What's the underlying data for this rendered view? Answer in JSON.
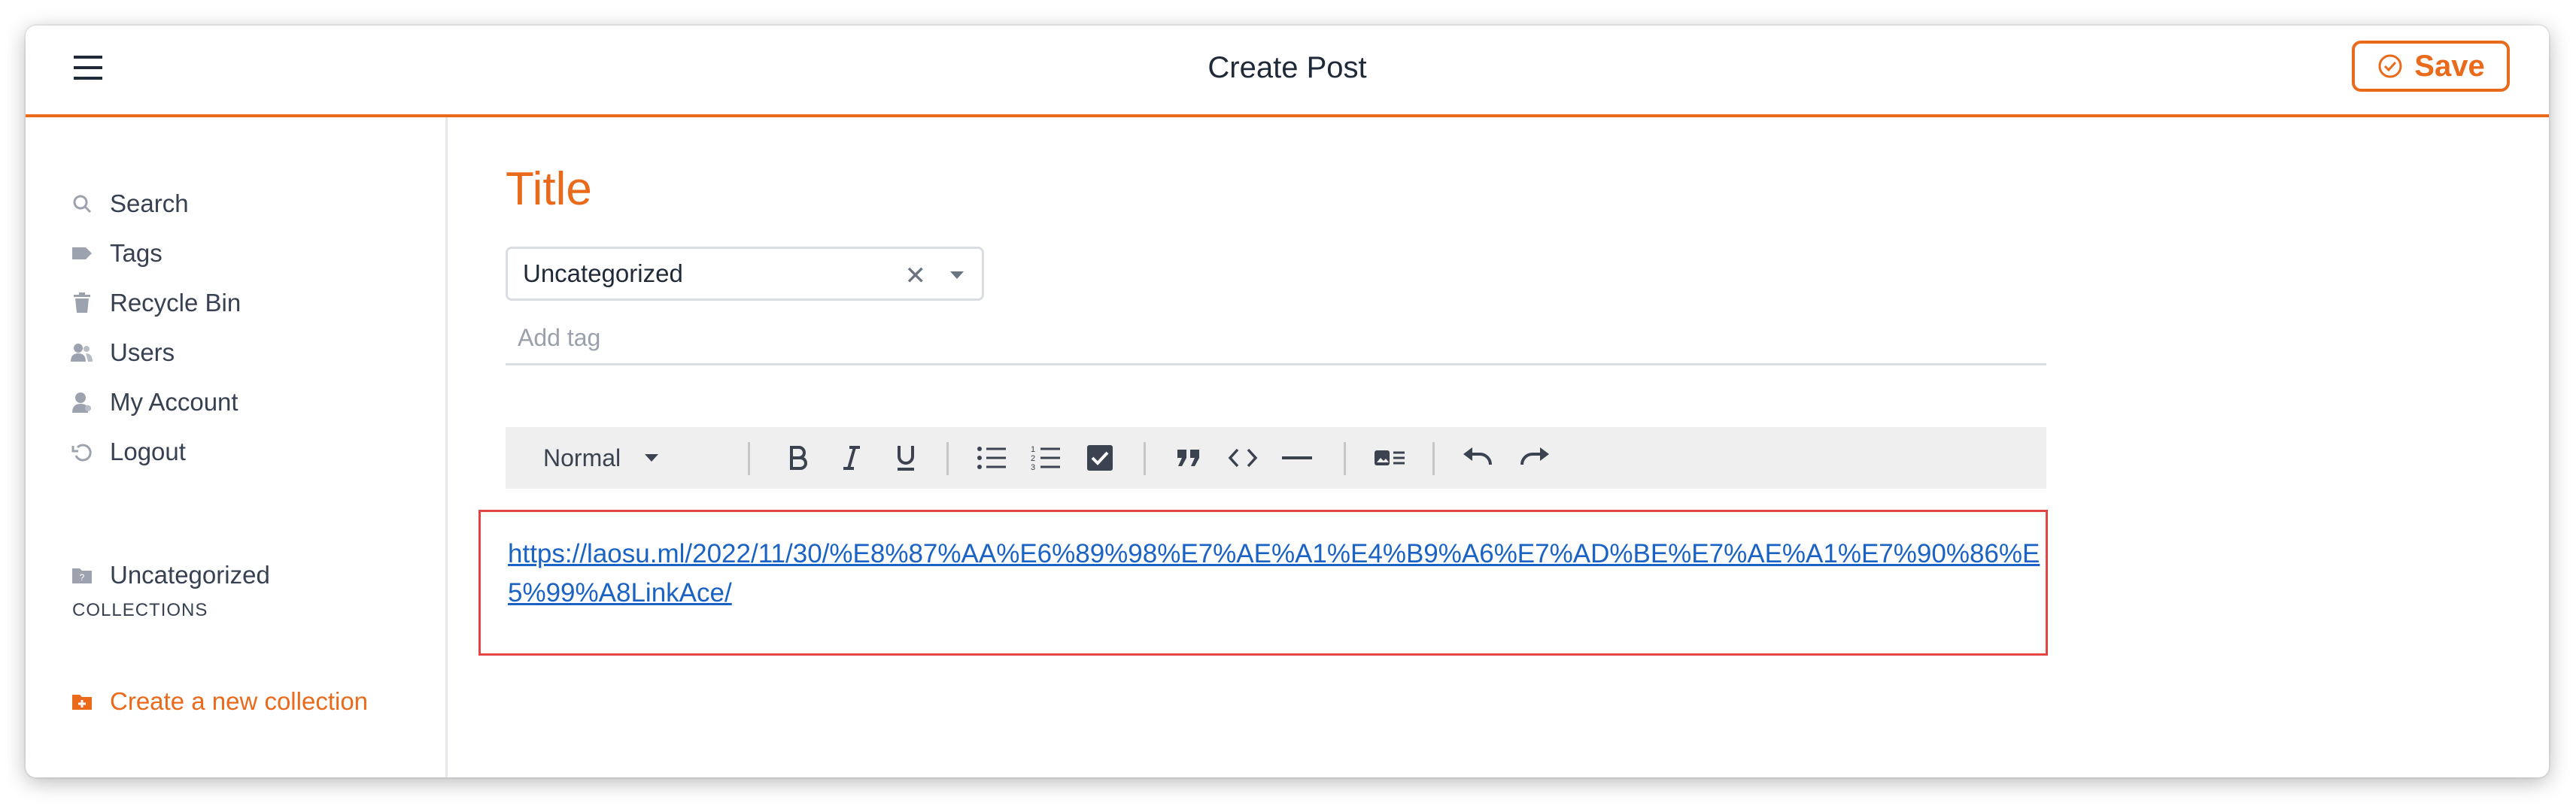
{
  "header": {
    "title": "Create Post",
    "save_label": "Save"
  },
  "sidebar": {
    "items": [
      {
        "label": "Search",
        "icon": "search-icon"
      },
      {
        "label": "Tags",
        "icon": "tag-icon"
      },
      {
        "label": "Recycle Bin",
        "icon": "trash-icon"
      },
      {
        "label": "Users",
        "icon": "users-icon"
      },
      {
        "label": "My Account",
        "icon": "account-icon"
      },
      {
        "label": "Logout",
        "icon": "logout-icon"
      }
    ],
    "collection_item": {
      "label": "Uncategorized",
      "icon": "folder-icon"
    },
    "collections_heading": "COLLECTIONS",
    "create_collection_label": "Create a new collection"
  },
  "post": {
    "title": "Title",
    "category": "Uncategorized",
    "tag_placeholder": "Add tag",
    "body_link": "https://laosu.ml/2022/11/30/%E8%87%AA%E6%89%98%E7%AE%A1%E4%B9%A6%E7%AD%BE%E7%AE%A1%E7%90%86%E5%99%A8LinkAce/"
  },
  "toolbar": {
    "format_label": "Normal",
    "buttons": [
      "bold-icon",
      "italic-icon",
      "underline-icon",
      "bullet-list-icon",
      "ordered-list-icon",
      "checklist-icon",
      "quote-icon",
      "code-icon",
      "horizontal-rule-icon",
      "embed-card-icon",
      "undo-icon",
      "redo-icon"
    ]
  },
  "colors": {
    "accent": "#ea6a1c",
    "link": "#1a63c5",
    "editor_border": "#e34545"
  }
}
